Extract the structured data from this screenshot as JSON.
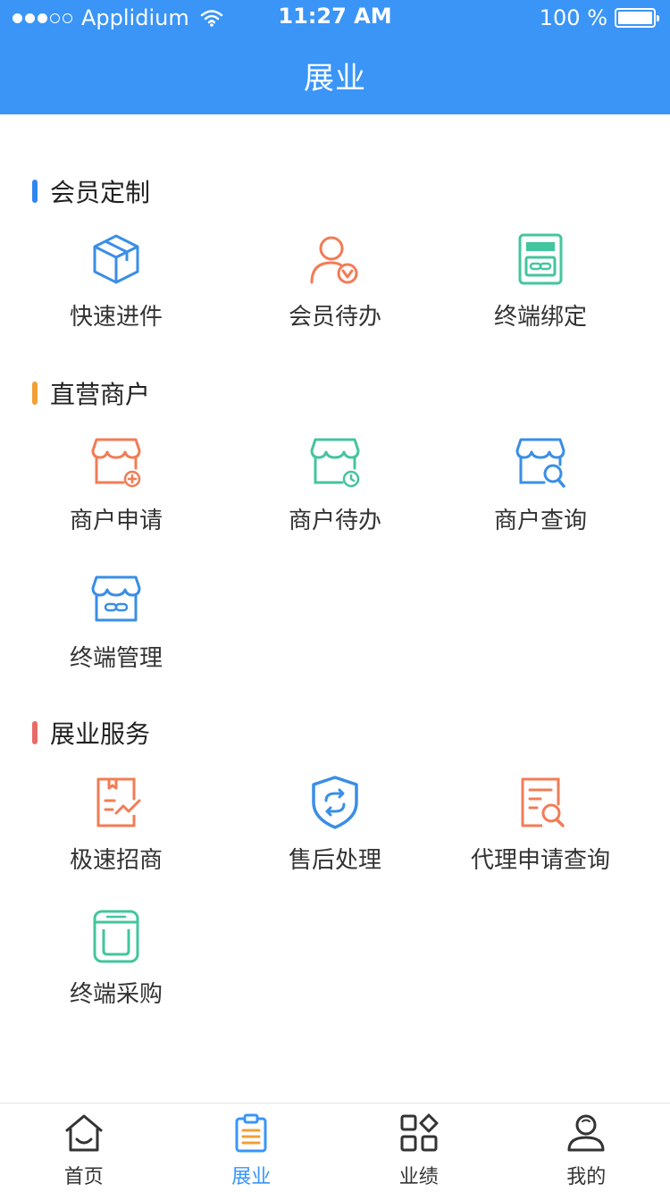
{
  "status_bar": {
    "carrier": "Applidium",
    "time": "11:27 AM",
    "battery": "100 %",
    "signal_icon": "signal-dots-icon",
    "wifi_icon": "wifi-icon",
    "battery_icon": "battery-icon"
  },
  "header": {
    "title": "展业"
  },
  "sections": [
    {
      "title": "会员定制",
      "accent": "#2f86ee",
      "items": [
        {
          "label": "快速进件",
          "icon": "package-icon",
          "color": "#3a8ee6"
        },
        {
          "label": "会员待办",
          "icon": "user-check-icon",
          "color": "#f27c55"
        },
        {
          "label": "终端绑定",
          "icon": "terminal-link-icon",
          "color": "#43c59e"
        }
      ]
    },
    {
      "title": "直营商户",
      "accent": "#f0a037",
      "items": [
        {
          "label": "商户申请",
          "icon": "store-add-icon",
          "color": "#f27c55"
        },
        {
          "label": "商户待办",
          "icon": "store-clock-icon",
          "color": "#43c59e"
        },
        {
          "label": "商户查询",
          "icon": "store-search-icon",
          "color": "#3a8ee6"
        },
        {
          "label": "终端管理",
          "icon": "store-link-icon",
          "color": "#3a8ee6"
        }
      ]
    },
    {
      "title": "展业服务",
      "accent": "#e86a6a",
      "items": [
        {
          "label": "极速招商",
          "icon": "document-chart-icon",
          "color": "#f27c55"
        },
        {
          "label": "售后处理",
          "icon": "shield-refresh-icon",
          "color": "#3a8ee6"
        },
        {
          "label": "代理申请查询",
          "icon": "document-search-icon",
          "color": "#f27c55"
        },
        {
          "label": "终端采购",
          "icon": "terminal-purchase-icon",
          "color": "#43c59e"
        }
      ]
    }
  ],
  "tabs": [
    {
      "label": "首页",
      "icon": "home-icon",
      "active": false
    },
    {
      "label": "展业",
      "icon": "clipboard-icon",
      "active": true
    },
    {
      "label": "业绩",
      "icon": "grid-apps-icon",
      "active": false
    },
    {
      "label": "我的",
      "icon": "user-icon",
      "active": false
    }
  ],
  "colors": {
    "brand": "#3a95f7",
    "tab_active": "#3a95f7",
    "tab_inactive": "#333333"
  }
}
